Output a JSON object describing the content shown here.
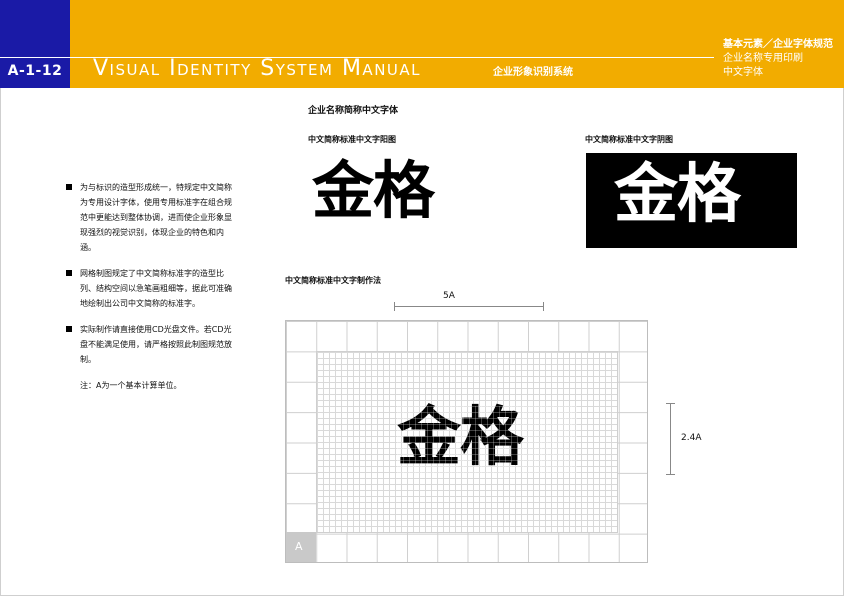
{
  "header": {
    "code": "A-1-12",
    "manual_title": "Visual Identity System Manual",
    "manual_subtitle": "企业形象识别系统",
    "section_lines": [
      "基本元素／企业字体规范",
      "企业名称专用印刷",
      "中文字体"
    ],
    "colors": {
      "bar": "#f2ac00",
      "code_box": "#1a1aa6"
    }
  },
  "main": {
    "title": "企业名称简称中文字体",
    "positive_label": "中文简称标准中文字阳图",
    "negative_label": "中文简称标准中文字阴图",
    "logo_text": "金格",
    "construction_label": "中文简称标准中文字制作法",
    "dimension_width": "5A",
    "dimension_height": "2.4A",
    "unit_label": "A"
  },
  "bullets": [
    "为与标识的造型形成统一，特规定中文简称为专用设计字体，使用专用标准字在组合规范中更能达到整体协调，进而使企业形象显现强烈的视觉识别，体现企业的特色和内涵。",
    "网格制图规定了中文简称标准字的造型比列、结构空间以急笔画粗细等，据此可准确地绘制出公司中文简称的标准字。",
    "实际制作请直接使用CD光盘文件。若CD光盘不能满足使用，请严格按照此制图规范放制。"
  ],
  "note": "注：A为一个基本计算单位。"
}
